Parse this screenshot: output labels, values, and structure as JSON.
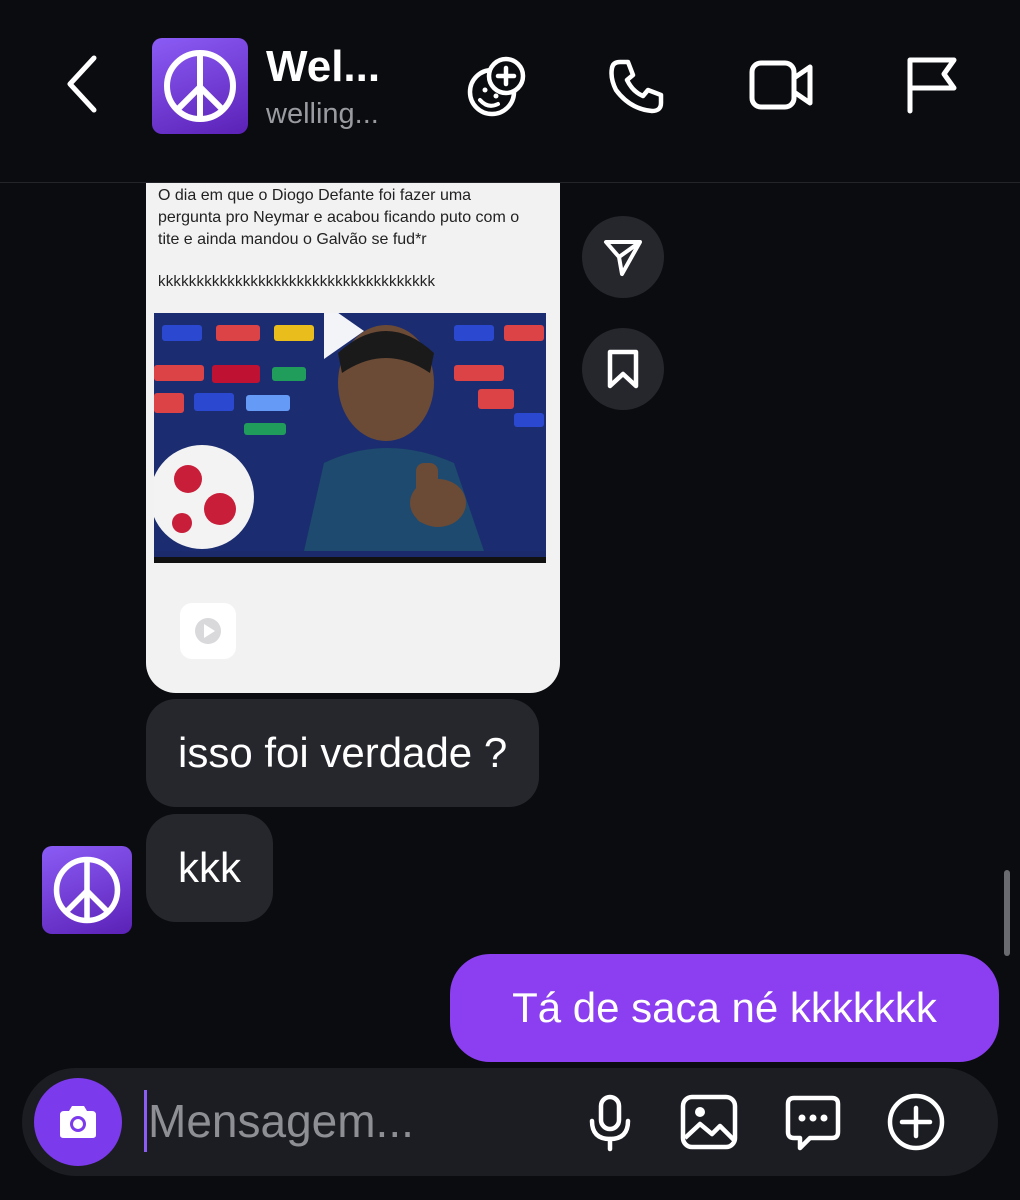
{
  "header": {
    "back_icon": "chevron-left-icon",
    "contact_name": "Wel...",
    "contact_handle": "welling...",
    "avatar_icon": "peace-sign-icon",
    "actions": [
      "add-emoji-icon",
      "phone-icon",
      "video-camera-icon",
      "flag-icon"
    ]
  },
  "shared_post": {
    "caption": "O dia em que o Diogo Defante  foi fazer uma pergunta pro Neymar e acabou ficando puto com o tite e ainda mandou o Galvão se fud*r",
    "laugh": "kkkkkkkkkkkkkkkkkkkkkkkkkkkkkkkkkkkk",
    "type_icon": "reel-play-icon",
    "side_actions": [
      "share-icon",
      "bookmark-icon"
    ]
  },
  "messages": [
    {
      "direction": "incoming",
      "text": "isso foi verdade ?"
    },
    {
      "direction": "incoming",
      "text": "kkk"
    },
    {
      "direction": "outgoing",
      "text": "Tá de saca né kkkkkkk"
    }
  ],
  "composer": {
    "placeholder": "Mensagem...",
    "left_icon": "camera-icon",
    "right_icons": [
      "microphone-icon",
      "image-icon",
      "sticker-chat-icon",
      "add-circle-icon"
    ]
  },
  "colors": {
    "background": "#0b0c10",
    "incoming_bubble": "#26272d",
    "outgoing_bubble": "#8b3ff0",
    "accent": "#7c3aed"
  }
}
